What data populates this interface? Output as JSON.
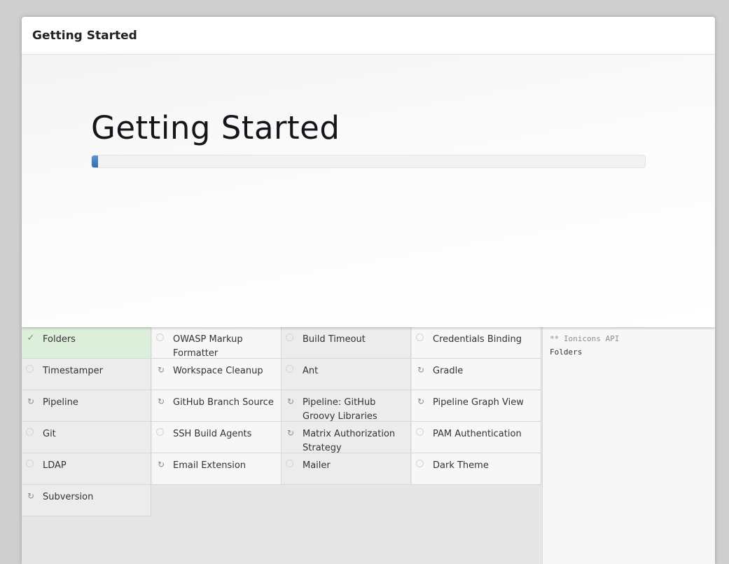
{
  "window": {
    "title": "Getting Started"
  },
  "hero": {
    "title": "Getting Started",
    "progress_fraction": 0.011,
    "accent_color": "#2f6db3"
  },
  "plugins": [
    {
      "label": "Folders",
      "status": "done"
    },
    {
      "label": "OWASP Markup Formatter",
      "status": "pending"
    },
    {
      "label": "Build Timeout",
      "status": "pending"
    },
    {
      "label": "Credentials Binding",
      "status": "pending"
    },
    {
      "label": "Timestamper",
      "status": "pending"
    },
    {
      "label": "Workspace Cleanup",
      "status": "dependency"
    },
    {
      "label": "Ant",
      "status": "pending"
    },
    {
      "label": "Gradle",
      "status": "dependency"
    },
    {
      "label": "Pipeline",
      "status": "dependency"
    },
    {
      "label": "GitHub Branch Source",
      "status": "dependency"
    },
    {
      "label": "Pipeline: GitHub Groovy Libraries",
      "status": "dependency"
    },
    {
      "label": "Pipeline Graph View",
      "status": "dependency"
    },
    {
      "label": "Git",
      "status": "pending"
    },
    {
      "label": "SSH Build Agents",
      "status": "pending"
    },
    {
      "label": "Matrix Authorization Strategy",
      "status": "dependency"
    },
    {
      "label": "PAM Authentication",
      "status": "pending"
    },
    {
      "label": "LDAP",
      "status": "pending"
    },
    {
      "label": "Email Extension",
      "status": "dependency"
    },
    {
      "label": "Mailer",
      "status": "pending"
    },
    {
      "label": "Dark Theme",
      "status": "pending"
    },
    {
      "label": "Subversion",
      "status": "dependency"
    }
  ],
  "log": {
    "lines": [
      {
        "text": "** Ionicons API",
        "dim": true
      },
      {
        "text": "Folders",
        "dim": false
      }
    ]
  },
  "icons": {
    "done": "check-icon",
    "dependency": "refresh-icon",
    "pending": "circle-icon"
  }
}
